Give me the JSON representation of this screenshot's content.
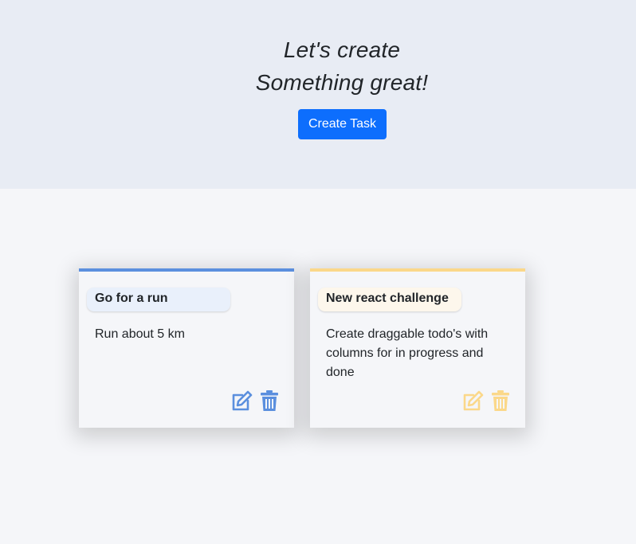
{
  "hero": {
    "line1": "Let's create",
    "line2": "Something great!",
    "button": "Create Task"
  },
  "colors": {
    "button": "#0d6efd",
    "card1_accent": "#5b8fde",
    "card1_title_bg": "#e9f0fb",
    "card2_accent": "#fbd88a",
    "card2_title_bg": "#fdf7ec"
  },
  "tasks": [
    {
      "title": "Go for a run",
      "description": "Run about 5 km",
      "edit_icon": "edit-icon",
      "delete_icon": "trash-icon"
    },
    {
      "title": "New react challenge",
      "description": "Create draggable todo's with columns for in progress and done",
      "edit_icon": "edit-icon",
      "delete_icon": "trash-icon"
    }
  ]
}
